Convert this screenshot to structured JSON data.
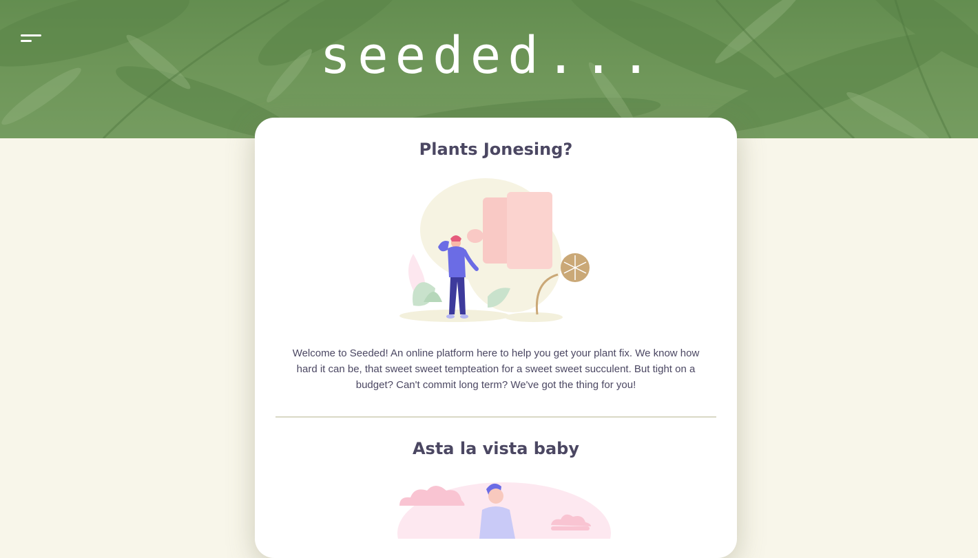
{
  "header": {
    "logo_text": "seeded...",
    "menu_icon": "hamburger-menu-icon"
  },
  "sections": [
    {
      "title": "Plants Jonesing?",
      "illustration": "person-pondering-plants-illustration",
      "body": "Welcome to Seeded! An online platform here to help you get your plant fix. We know how hard it can be, that sweet sweet tempteation for a sweet sweet succulent. But tight on a budget? Can't commit long term? We've got the thing for you!"
    },
    {
      "title": "Asta la vista baby",
      "illustration": "person-with-clouds-illustration"
    }
  ],
  "colors": {
    "page_background": "#f8f6ea",
    "hero_green": "#6e9658",
    "card_background": "#ffffff",
    "text": "#4b4762",
    "divider": "#d9d8c5"
  }
}
